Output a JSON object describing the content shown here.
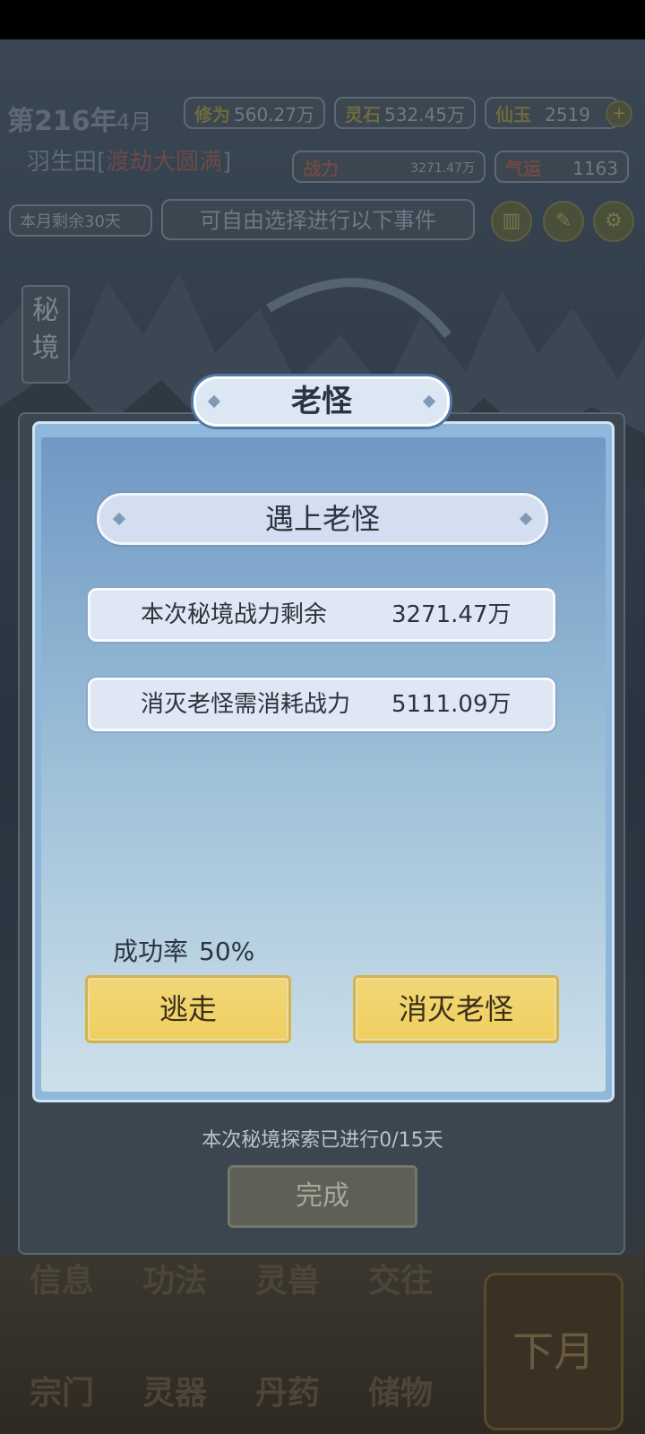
{
  "background": {
    "year_label": "第216年",
    "month_label": "4月",
    "cultivation": {
      "key": "修为",
      "value": "560.27万"
    },
    "spirit_stone": {
      "key": "灵石",
      "value": "532.45万"
    },
    "jade": {
      "key": "仙玉",
      "value": "2519"
    },
    "character_name": "羽生田",
    "realm": "渡劫大圆满",
    "power": {
      "key": "战力",
      "value": "3271.47万"
    },
    "luck": {
      "key": "气运",
      "value": "1163"
    },
    "days_left": "本月剩余30天",
    "hint": "可自由选择进行以下事件",
    "side_tab": "秘境",
    "nav_top": [
      "信息",
      "功法",
      "灵兽",
      "交往"
    ],
    "nav_bottom": [
      "宗门",
      "灵器",
      "丹药",
      "储物"
    ],
    "next_month": "下月"
  },
  "dialog": {
    "title": "老怪",
    "section_title": "遇上老怪",
    "remaining_power_label": "本次秘境战力剩余",
    "remaining_power_value": "3271.47万",
    "cost_label": "消灭老怪需消耗战力",
    "cost_value": "5111.09万",
    "success_rate_label": "成功率",
    "success_rate_value": "50%",
    "flee_button": "逃走",
    "eliminate_button": "消灭老怪",
    "progress_text": "本次秘境探索已进行0/15天",
    "done_button": "完成"
  },
  "colors": {
    "gold_button": "#efcf5e",
    "panel_blue": "#8fb7db",
    "text_dark": "#2b3440"
  }
}
